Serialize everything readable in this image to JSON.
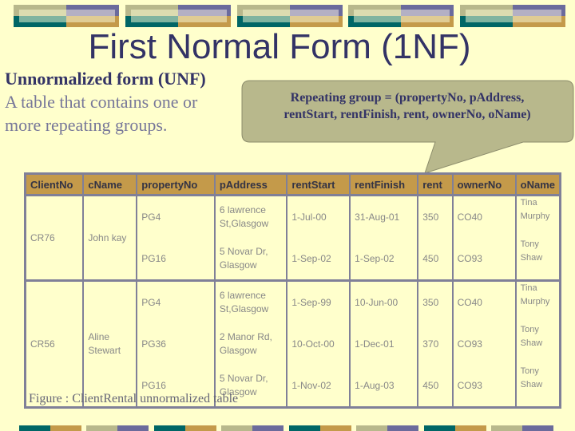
{
  "slide": {
    "title": "First Normal Form (1NF)",
    "unf_heading": "Unnormalized form (UNF)",
    "unf_description_line1": "A table that contains one or",
    "unf_description_line2": "more repeating groups.",
    "callout_line1": "Repeating group = (propertyNo, pAddress,",
    "callout_line2": "rentStart, rentFinish, rent, ownerNo, oName)",
    "caption": "Figure : ClientRental unnormalized table"
  },
  "colors": {
    "background": "#ffffcc",
    "title": "#333366",
    "header_fill": "#c49a4a",
    "callout_fill": "#b8b88c",
    "border": "#808098"
  },
  "table": {
    "columns": [
      "ClientNo",
      "cName",
      "propertyNo",
      "pAddress",
      "rentStart",
      "rentFinish",
      "rent",
      "ownerNo",
      "oName"
    ],
    "groups": [
      {
        "clientNo": "CR76",
        "cName": "John kay",
        "rows": [
          {
            "propertyNo": "PG4",
            "pAddress": "6 lawrence St,Glasgow",
            "rentStart": "1-Jul-00",
            "rentFinish": "31-Aug-01",
            "rent": "350",
            "ownerNo": "CO40",
            "oName": "Tina Murphy"
          },
          {
            "propertyNo": "PG16",
            "pAddress": "5 Novar Dr, Glasgow",
            "rentStart": "1-Sep-02",
            "rentFinish": "1-Sep-02",
            "rent": "450",
            "ownerNo": "CO93",
            "oName": "Tony Shaw"
          }
        ]
      },
      {
        "clientNo": "CR56",
        "cName": "Aline Stewart",
        "rows": [
          {
            "propertyNo": "PG4",
            "pAddress": "6 lawrence St,Glasgow",
            "rentStart": "1-Sep-99",
            "rentFinish": "10-Jun-00",
            "rent": "350",
            "ownerNo": "CO40",
            "oName": "Tina Murphy"
          },
          {
            "propertyNo": "PG36",
            "pAddress": "2 Manor Rd, Glasgow",
            "rentStart": "10-Oct-00",
            "rentFinish": "1-Dec-01",
            "rent": "370",
            "ownerNo": "CO93",
            "oName": "Tony Shaw"
          },
          {
            "propertyNo": "PG16",
            "pAddress": "5 Novar Dr, Glasgow",
            "rentStart": "1-Nov-02",
            "rentFinish": "1-Aug-03",
            "rent": "450",
            "ownerNo": "CO93",
            "oName": "Tony Shaw"
          }
        ]
      }
    ]
  }
}
